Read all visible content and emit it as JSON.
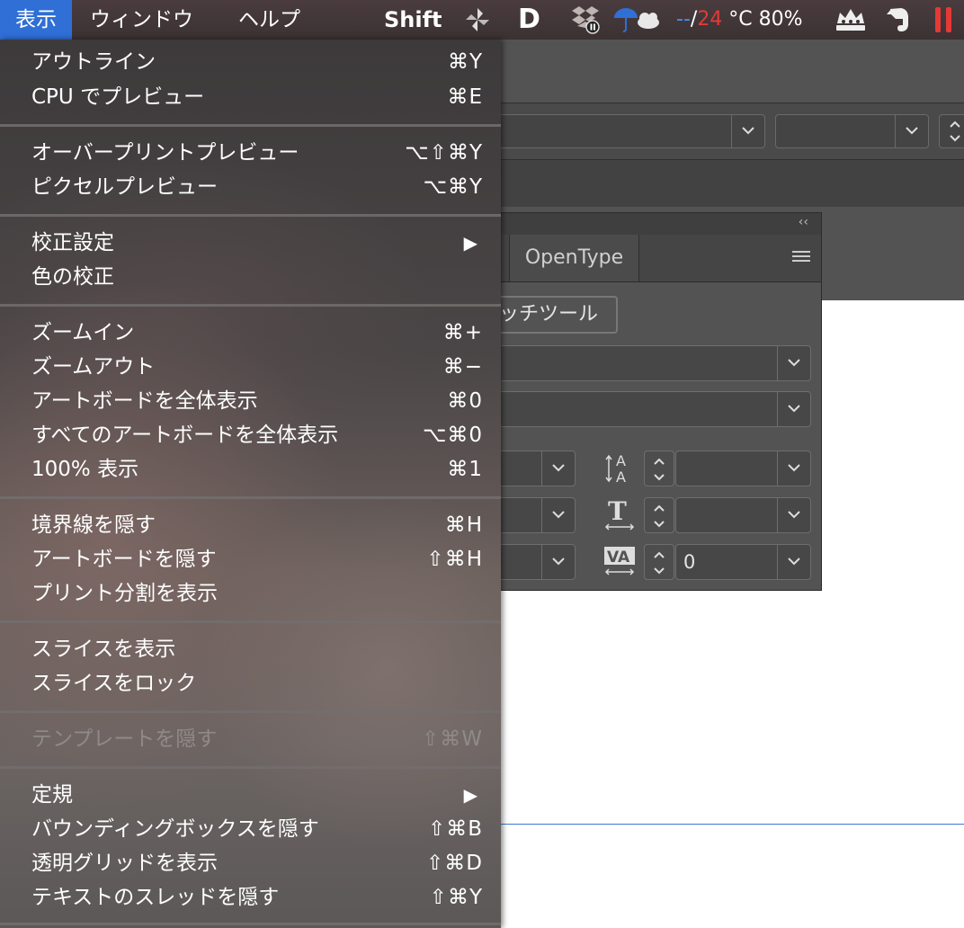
{
  "menubar": {
    "view": "表示",
    "window": "ウィンドウ",
    "help": "ヘルプ"
  },
  "status": {
    "shift": "Shift",
    "d_logo": "D",
    "temp_lo": "--",
    "temp_slash": "/",
    "temp_hi": "24",
    "temp_rest": " °C 80%",
    "icons": [
      "pinwheel-icon",
      "d-app-icon",
      "dropbox-icon",
      "weather-umbrella-cloud-icon",
      "crown-icon",
      "evernote-icon",
      "pause-icon"
    ]
  },
  "menu": {
    "items": [
      {
        "label": "アウトライン",
        "shortcut": "⌘Y"
      },
      {
        "label": "CPU でプレビュー",
        "shortcut": "⌘E"
      },
      {
        "label": "オーバープリントプレビュー",
        "shortcut": "⌥⇧⌘Y"
      },
      {
        "label": "ピクセルプレビュー",
        "shortcut": "⌥⌘Y"
      },
      {
        "label": "校正設定",
        "shortcut": "▶"
      },
      {
        "label": "色の校正",
        "shortcut": ""
      },
      {
        "label": "ズームイン",
        "shortcut": "⌘+"
      },
      {
        "label": "ズームアウト",
        "shortcut": "⌘−"
      },
      {
        "label": "アートボードを全体表示",
        "shortcut": "⌘0"
      },
      {
        "label": "すべてのアートボードを全体表示",
        "shortcut": "⌥⌘0"
      },
      {
        "label": "100% 表示",
        "shortcut": "⌘1"
      },
      {
        "label": "境界線を隠す",
        "shortcut": "⌘H"
      },
      {
        "label": "アートボードを隠す",
        "shortcut": "⇧⌘H"
      },
      {
        "label": "プリント分割を表示",
        "shortcut": ""
      },
      {
        "label": "スライスを表示",
        "shortcut": ""
      },
      {
        "label": "スライスをロック",
        "shortcut": ""
      },
      {
        "label": "テンプレートを隠す",
        "shortcut": "⇧⌘W"
      },
      {
        "label": "定規",
        "shortcut": "▶"
      },
      {
        "label": "バウンディングボックスを隠す",
        "shortcut": "⇧⌘B"
      },
      {
        "label": "透明グリッドを表示",
        "shortcut": "⇧⌘D"
      },
      {
        "label": "テキストのスレッドを隠す",
        "shortcut": "⇧⌘Y"
      }
    ]
  },
  "panel": {
    "collapse": "‹‹",
    "tab_opentype": "OpenType",
    "touch_tool": "ッチツール",
    "tracking_value": "0"
  }
}
